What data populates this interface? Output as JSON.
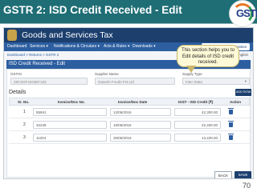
{
  "slide": {
    "title": "GSTR 2: ISD Credit Received - Edit",
    "page_number": "70",
    "logo_text": "GSTN"
  },
  "app": {
    "title": "Goods and Services Tax",
    "nav": [
      "Dashboard",
      "Services ▾",
      "Notifications & Circulars ▾",
      "Acts & Rules ▾",
      "Downloads ▾"
    ],
    "user": "Ganesh Harrel Industries"
  },
  "breadcrumb": "Dashboard > Returns > GSTR 2",
  "language": "English",
  "card_title": "ISD Credit Received - Edit",
  "form": {
    "gstin_label": "GSTIN",
    "gstin_value": "29CSDF4323EF1Z5",
    "supplier_label": "Supplier Name",
    "supplier_value": "Ganesh Foods Pvt Ltd",
    "supply_label": "Supply Type",
    "supply_value": "Inter-State"
  },
  "details_label": "Details",
  "add_row_label": "ADD ROW",
  "table": {
    "headers": [
      "Sr. No.",
      "Invoice/Doc No.",
      "Invoice/Doc Date",
      "IGST - ISD Credit (₹)",
      "Action"
    ],
    "rows": [
      {
        "sr": "1",
        "invoice": "55941",
        "date": "12/06/2016",
        "amount": "42,300.00"
      },
      {
        "sr": "2",
        "invoice": "32235",
        "date": "18/06/2016",
        "amount": "22,400.00"
      },
      {
        "sr": "3",
        "invoice": "11204",
        "date": "25/06/2016",
        "amount": "13,430.00"
      }
    ]
  },
  "buttons": {
    "back": "BACK",
    "save": "SAVE"
  },
  "callout": "This section helps you to Edit details of ISD credit received."
}
